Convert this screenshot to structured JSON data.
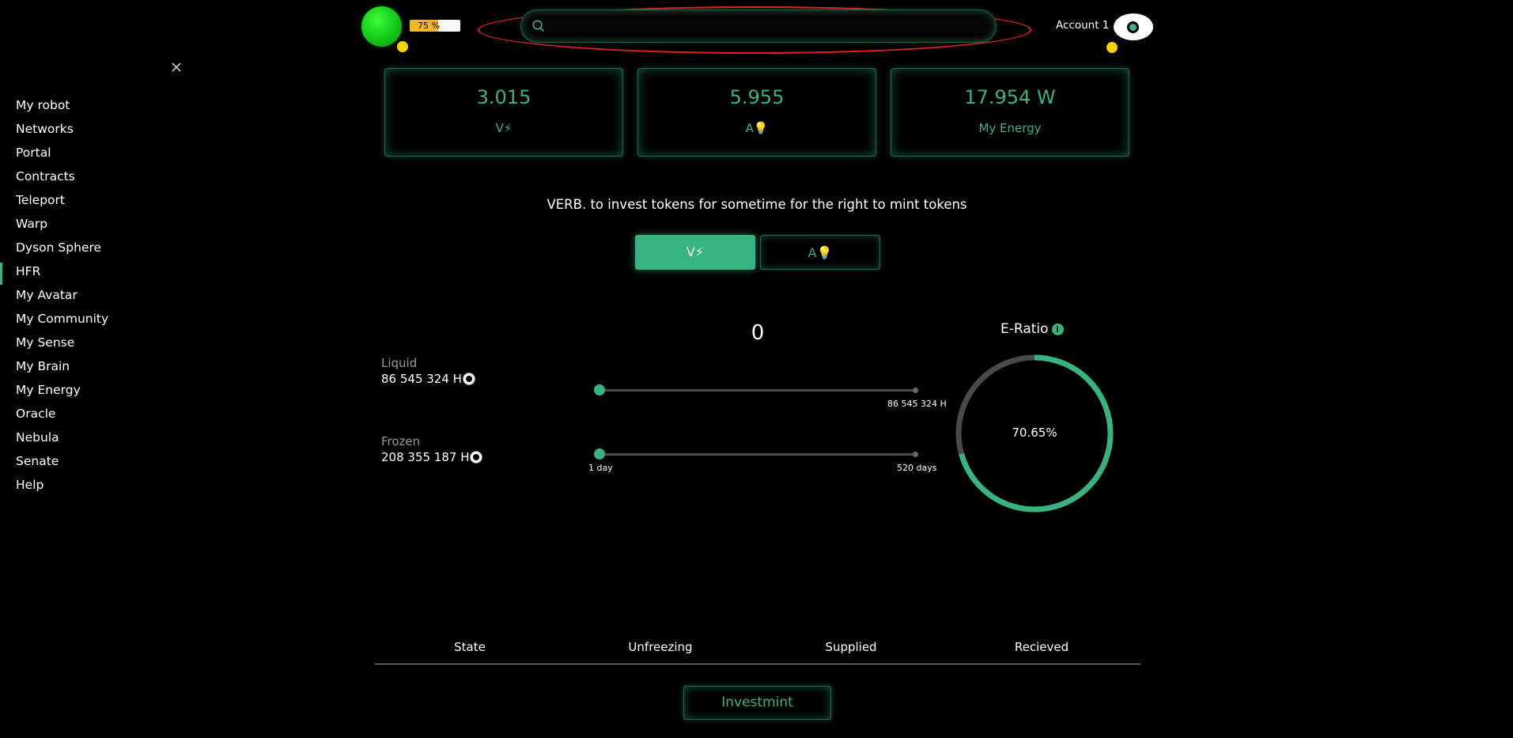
{
  "header": {
    "battery_text": "75 %",
    "battery_level": 0.75,
    "search_placeholder": "",
    "account_label": "Account 1"
  },
  "sidebar": {
    "active_index": 7,
    "items": [
      {
        "label": "My robot"
      },
      {
        "label": "Networks"
      },
      {
        "label": "Portal"
      },
      {
        "label": "Contracts"
      },
      {
        "label": "Teleport"
      },
      {
        "label": "Warp"
      },
      {
        "label": "Dyson Sphere"
      },
      {
        "label": "HFR"
      },
      {
        "label": "My Avatar"
      },
      {
        "label": "My Community"
      },
      {
        "label": "My Sense"
      },
      {
        "label": "My Brain"
      },
      {
        "label": "My Energy"
      },
      {
        "label": "Oracle"
      },
      {
        "label": "Nebula"
      },
      {
        "label": "Senate"
      },
      {
        "label": "Help"
      }
    ]
  },
  "cards": {
    "v_value": "3.015",
    "v_label": "V⚡",
    "a_value": "5.955",
    "a_label": "A💡",
    "energy_value": "17.954 W",
    "energy_label": "My Energy"
  },
  "description": "VERB. to invest tokens for sometime for the right to mint tokens",
  "toggles": {
    "v_label": "V⚡",
    "a_label": "A💡"
  },
  "balances": {
    "liquid_label": "Liquid",
    "liquid_value": "86 545 324 H",
    "frozen_label": "Frozen",
    "frozen_value": "208 355 187 H"
  },
  "amount": "0",
  "amount_slider": {
    "position": 0,
    "max_label": "86 545 324 H"
  },
  "days_slider": {
    "position": 0,
    "min_label": "1 day",
    "max_label": "520 days"
  },
  "eratio": {
    "title": "E-Ratio",
    "info_icon": "i",
    "percent_text": "70.65%",
    "fraction": 0.7065,
    "fill_color": "#36b37e",
    "track_color": "#4a4a4a"
  },
  "table": {
    "columns": [
      "State",
      "Unfreezing",
      "Supplied",
      "Recieved"
    ]
  },
  "action": {
    "investmint_label": "Investmint"
  },
  "colors": {
    "accent": "#36b37e",
    "highlight_ellipse": "#e61e1e",
    "robot_status": "#17d11b",
    "indicator": "#f5d300"
  }
}
